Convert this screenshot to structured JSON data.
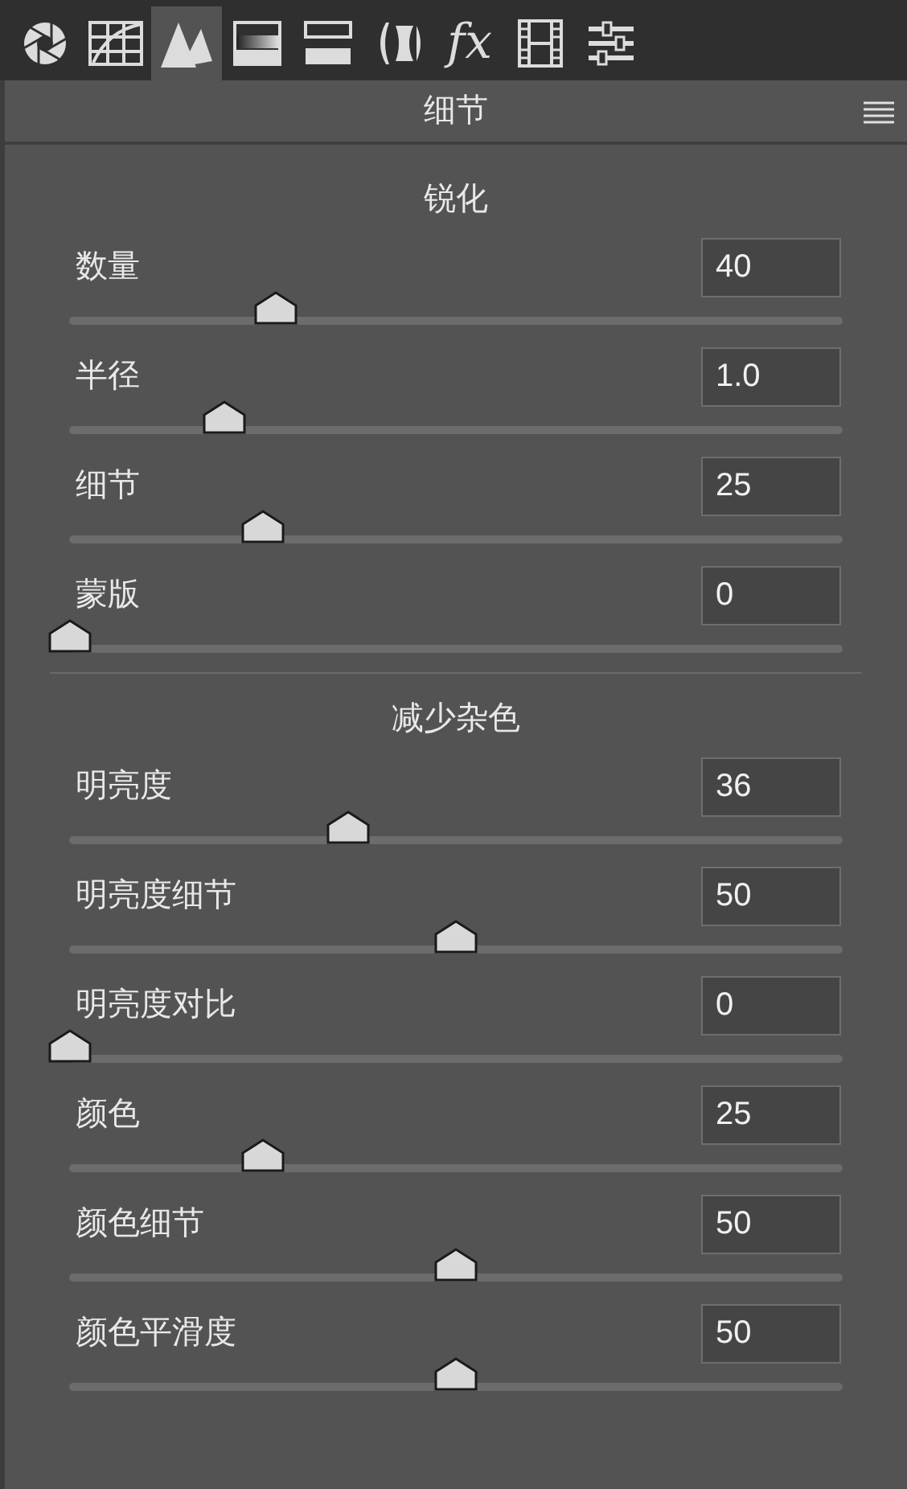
{
  "toolbar": [
    {
      "kind": "aperture",
      "selected": false
    },
    {
      "kind": "curve",
      "selected": false
    },
    {
      "kind": "detail",
      "selected": true
    },
    {
      "kind": "hsl",
      "selected": false
    },
    {
      "kind": "split",
      "selected": false
    },
    {
      "kind": "lens",
      "selected": false
    },
    {
      "kind": "fx",
      "label": "fx",
      "selected": false
    },
    {
      "kind": "film",
      "selected": false
    },
    {
      "kind": "sliders",
      "selected": false
    }
  ],
  "panel_title": "细节",
  "sections": [
    {
      "title": "锐化",
      "sliders": [
        {
          "name": "数量",
          "value": "40",
          "level": 0.267
        },
        {
          "name": "半径",
          "value": "1.0",
          "level": 0.2
        },
        {
          "name": "细节",
          "value": "25",
          "level": 0.25
        },
        {
          "name": "蒙版",
          "value": "0",
          "level": 0
        }
      ]
    },
    {
      "title": "减少杂色",
      "sliders": [
        {
          "name": "明亮度",
          "value": "36",
          "level": 0.36
        },
        {
          "name": "明亮度细节",
          "value": "50",
          "level": 0.5
        },
        {
          "name": "明亮度对比",
          "value": "0",
          "level": 0
        },
        {
          "name": "颜色",
          "value": "25",
          "level": 0.25
        },
        {
          "name": "颜色细节",
          "value": "50",
          "level": 0.5
        },
        {
          "name": "颜色平滑度",
          "value": "50",
          "level": 0.5
        }
      ]
    }
  ]
}
